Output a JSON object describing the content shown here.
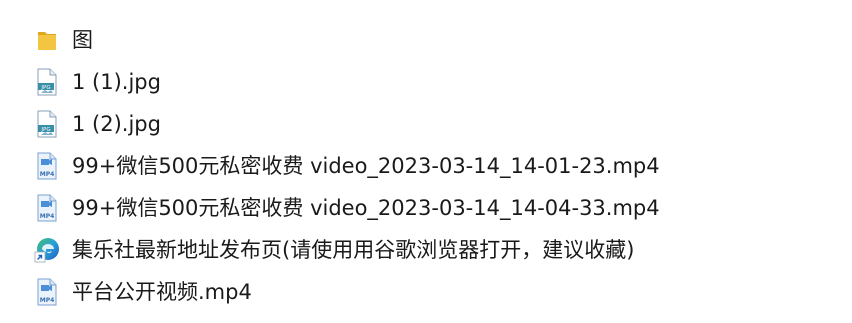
{
  "files": [
    {
      "name": "图",
      "icon": "folder-icon"
    },
    {
      "name": "1 (1).jpg",
      "icon": "jpg-file-icon",
      "badge": "JPG"
    },
    {
      "name": "1 (2).jpg",
      "icon": "jpg-file-icon",
      "badge": "JPG"
    },
    {
      "name": "99+微信500元私密收费 video_2023-03-14_14-01-23.mp4",
      "icon": "mp4-file-icon",
      "badge": "MP4"
    },
    {
      "name": "99+微信500元私密收费 video_2023-03-14_14-04-33.mp4",
      "icon": "mp4-file-icon",
      "badge": "MP4"
    },
    {
      "name": "集乐社最新地址发布页(请使用用谷歌浏览器打开，建议收藏)",
      "icon": "edge-shortcut-icon"
    },
    {
      "name": "平台公开视频.mp4",
      "icon": "mp4-file-icon",
      "badge": "MP4"
    }
  ],
  "colors": {
    "folder": "#f4c542",
    "folder_dark": "#e0a820",
    "file_border": "#7aa3cf",
    "mp4_blue": "#4a8fd8",
    "jpg_teal": "#3a8fa8",
    "edge_blue": "#1f7fd6",
    "edge_green": "#3fbf6a"
  }
}
